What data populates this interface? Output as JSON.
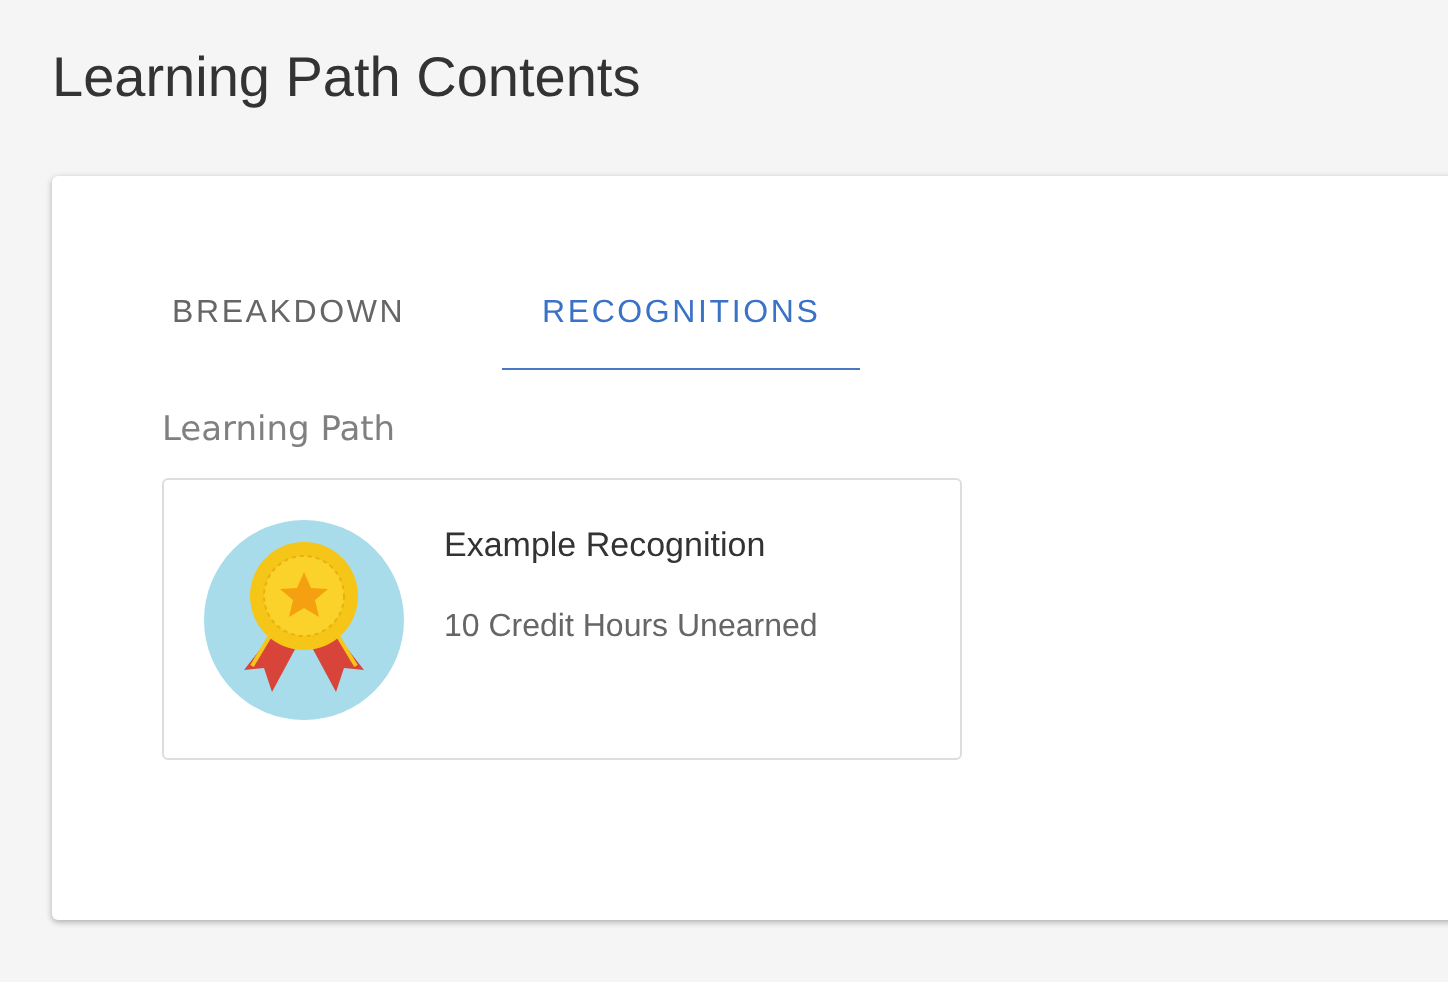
{
  "page": {
    "title": "Learning Path Contents"
  },
  "tabs": [
    {
      "label": "BREAKDOWN",
      "selected": false
    },
    {
      "label": "RECOGNITIONS",
      "selected": true
    }
  ],
  "section": {
    "heading": "Learning Path"
  },
  "recognitions": [
    {
      "title": "Example Recognition",
      "status": "10 Credit Hours Unearned"
    }
  ]
}
